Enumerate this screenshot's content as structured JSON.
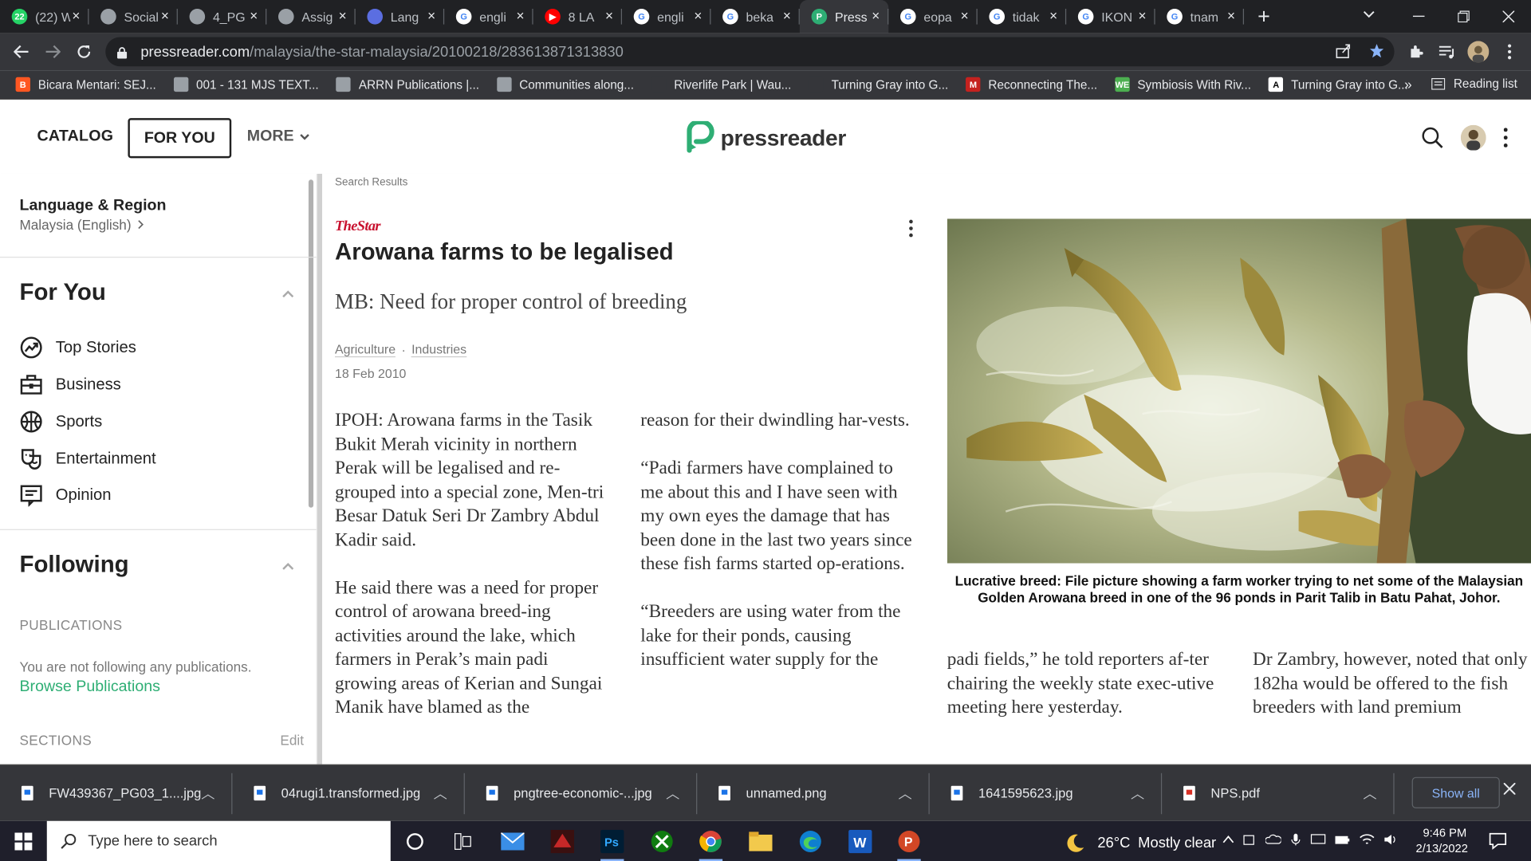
{
  "browser": {
    "tabs": [
      {
        "title": "(22) W",
        "color": "#25d366",
        "glyph": "22"
      },
      {
        "title": "Social",
        "color": "#9aa0a6",
        "glyph": ""
      },
      {
        "title": "4_PG",
        "color": "#9aa0a6",
        "glyph": ""
      },
      {
        "title": "Assig",
        "color": "#9aa0a6",
        "glyph": ""
      },
      {
        "title": "Lang",
        "color": "#5b6ee1",
        "glyph": ""
      },
      {
        "title": "engli",
        "color": "#ffffff",
        "glyph": "G"
      },
      {
        "title": "8 LA",
        "color": "#ff0000",
        "glyph": "▶"
      },
      {
        "title": "engli",
        "color": "#ffffff",
        "glyph": "G"
      },
      {
        "title": "beka",
        "color": "#ffffff",
        "glyph": "G"
      },
      {
        "title": "Press",
        "color": "#2eae74",
        "glyph": "P",
        "active": true
      },
      {
        "title": "eopa",
        "color": "#ffffff",
        "glyph": "G"
      },
      {
        "title": "tidak",
        "color": "#ffffff",
        "glyph": "G"
      },
      {
        "title": "IKON",
        "color": "#ffffff",
        "glyph": "G"
      },
      {
        "title": "tnam",
        "color": "#ffffff",
        "glyph": "G"
      }
    ],
    "new_tab_glyph": "+",
    "url_host": "pressreader.com",
    "url_path": "/malaysia/the-star-malaysia/20100218/283613871313830",
    "bookmarks": [
      {
        "label": "Bicara Mentari: SEJ...",
        "color": "#ff5722",
        "glyph": "B"
      },
      {
        "label": "001 - 131 MJS TEXT...",
        "color": "#9aa0a6",
        "glyph": ""
      },
      {
        "label": "ARRN Publications |...",
        "color": "#9aa0a6",
        "glyph": ""
      },
      {
        "label": "Communities along...",
        "color": "#9aa0a6",
        "glyph": ""
      },
      {
        "label": "Riverlife Park | Wau...",
        "color": "#35363a",
        "glyph": ""
      },
      {
        "label": "Turning Gray into G...",
        "color": "#35363a",
        "glyph": ""
      },
      {
        "label": "Reconnecting The...",
        "color": "#c5221f",
        "glyph": "M"
      },
      {
        "label": "Symbiosis With Riv...",
        "color": "#4caf50",
        "glyph": "WE"
      },
      {
        "label": "Turning Gray into G...",
        "color": "#ffffff",
        "glyph": "A"
      }
    ],
    "bookmarks_more": "»",
    "reading_list": "Reading list"
  },
  "site": {
    "nav_catalog": "CATALOG",
    "nav_foryou": "FOR YOU",
    "nav_more": "MORE",
    "logo_text": "pressreader",
    "brand_color": "#2eae74"
  },
  "sidebar": {
    "lang_title": "Language & Region",
    "lang_value": "Malaysia (English)",
    "foryou_title": "For You",
    "items": [
      {
        "label": "Top Stories"
      },
      {
        "label": "Business"
      },
      {
        "label": "Sports"
      },
      {
        "label": "Entertainment"
      },
      {
        "label": "Opinion"
      }
    ],
    "following_title": "Following",
    "publications_label": "PUBLICATIONS",
    "publications_empty": "You are not following any publications.",
    "browse_link": "Browse Publications",
    "sections_label": "SECTIONS",
    "edit_label": "Edit"
  },
  "article": {
    "breadcrumb": "Search Results",
    "publication_logo": "TheStar",
    "headline": "Arowana farms to be legalised",
    "dek": "MB: Need for proper control of breeding",
    "tags": [
      "Agriculture",
      "Industries"
    ],
    "date": "18 Feb 2010",
    "col1": [
      "IPOH: Arowana farms in the Tasik Bukit Merah vicinity in northern Perak will be legalised and re-grouped into a special zone, Men-tri Besar Datuk Seri Dr Zambry Abdul Kadir said.",
      "He said there was a need for proper control of arowana breed-ing activities around the lake, which farmers in Perak’s main padi growing areas of Kerian and Sungai Manik have blamed as the"
    ],
    "col2": [
      "reason for their dwindling har-vests.",
      "“Padi farmers have complained to me about this and I have seen with my own eyes the damage that has been done in the last two years since these fish farms started op-erations.",
      "“Breeders are using water from the lake for their ponds, causing insufficient water supply for the"
    ],
    "col3": "padi fields,” he told reporters af-ter chairing the weekly state exec-utive meeting here yesterday.",
    "col4": "Dr Zambry, however, noted that only 182ha would be offered to the fish breeders with land premium",
    "caption": "Lucrative breed: File picture showing a farm worker trying to net some of the Malaysian Golden Arowana breed in one of the 96 ponds in Parit Talib in Batu Pahat, Johor."
  },
  "downloads": {
    "items": [
      {
        "name": "FW439367_PG03_1....jpg",
        "type": "image"
      },
      {
        "name": "04rugi1.transformed.jpg",
        "type": "image"
      },
      {
        "name": "pngtree-economic-...jpg",
        "type": "image"
      },
      {
        "name": "unnamed.png",
        "type": "image"
      },
      {
        "name": "1641595623.jpg",
        "type": "image"
      },
      {
        "name": "NPS.pdf",
        "type": "pdf"
      }
    ],
    "show_all": "Show all"
  },
  "taskbar": {
    "search_placeholder": "Type here to search",
    "weather_temp": "26°C",
    "weather_text": "Mostly clear",
    "time": "9:46 PM",
    "date": "2/13/2022"
  }
}
